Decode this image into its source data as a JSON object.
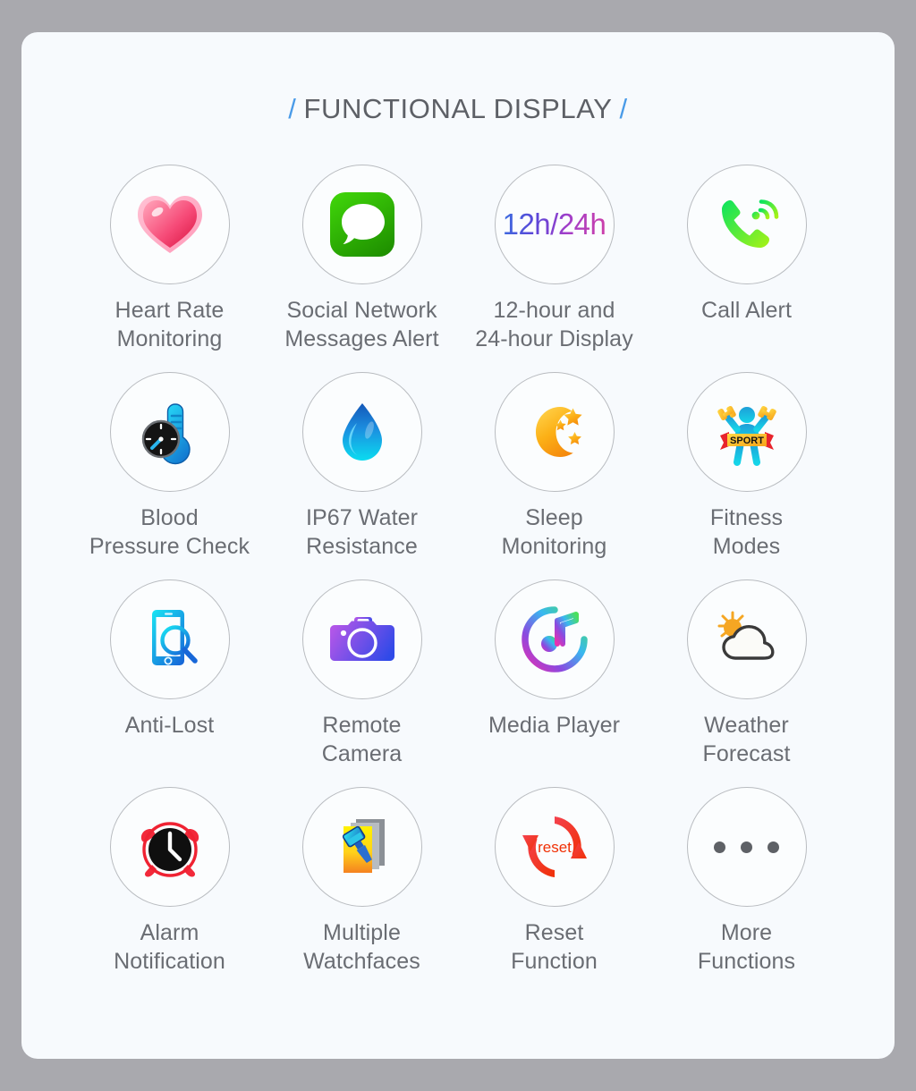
{
  "page": {
    "background_color": "#a9a9ae",
    "card_color": "#f7fafd"
  },
  "header": {
    "slash_left": "/",
    "title": "FUNCTIONAL DISPLAY",
    "slash_right": "/",
    "title_color": "#5d6066",
    "slash_color": "#4a9be8"
  },
  "features": [
    {
      "icon": "heart-icon",
      "label": "Heart Rate\nMonitoring",
      "color": "#f2486f"
    },
    {
      "icon": "message-bubble-icon",
      "label": "Social Network\nMessages Alert",
      "color": "#2db200"
    },
    {
      "icon": "time-format-icon",
      "label": "12-hour and\n24-hour Display",
      "color": "#5a46d8",
      "text": "12h/24h"
    },
    {
      "icon": "phone-call-icon",
      "label": "Call Alert",
      "color": "#45e04a"
    },
    {
      "icon": "thermometer-gauge-icon",
      "label": "Blood\nPressure Check",
      "color": "#19b6ef"
    },
    {
      "icon": "water-drop-icon",
      "label": "IP67 Water\nResistance",
      "color": "#1474d6"
    },
    {
      "icon": "moon-stars-icon",
      "label": "Sleep\nMonitoring",
      "color": "#f7a81b"
    },
    {
      "icon": "sport-figure-icon",
      "label": "Fitness\nModes",
      "color": "#1e9fd8",
      "badge": "SPORT"
    },
    {
      "icon": "phone-search-icon",
      "label": "Anti-Lost",
      "color": "#17b8e8"
    },
    {
      "icon": "camera-icon",
      "label": "Remote\nCamera",
      "color": "#8b4bdd"
    },
    {
      "icon": "music-note-ring-icon",
      "label": "Media Player",
      "color": "#b44ad0"
    },
    {
      "icon": "sun-cloud-icon",
      "label": "Weather\nForecast",
      "color": "#f5a623"
    },
    {
      "icon": "alarm-clock-icon",
      "label": "Alarm\nNotification",
      "color": "#e8232a"
    },
    {
      "icon": "watchface-brush-icon",
      "label": "Multiple\nWatchfaces",
      "color": "#f5c518"
    },
    {
      "icon": "reset-arrows-icon",
      "label": "Reset\nFunction",
      "color": "#f0302a",
      "text": "reset"
    },
    {
      "icon": "ellipsis-icon",
      "label": "More\nFunctions",
      "color": "#5e6166"
    }
  ]
}
